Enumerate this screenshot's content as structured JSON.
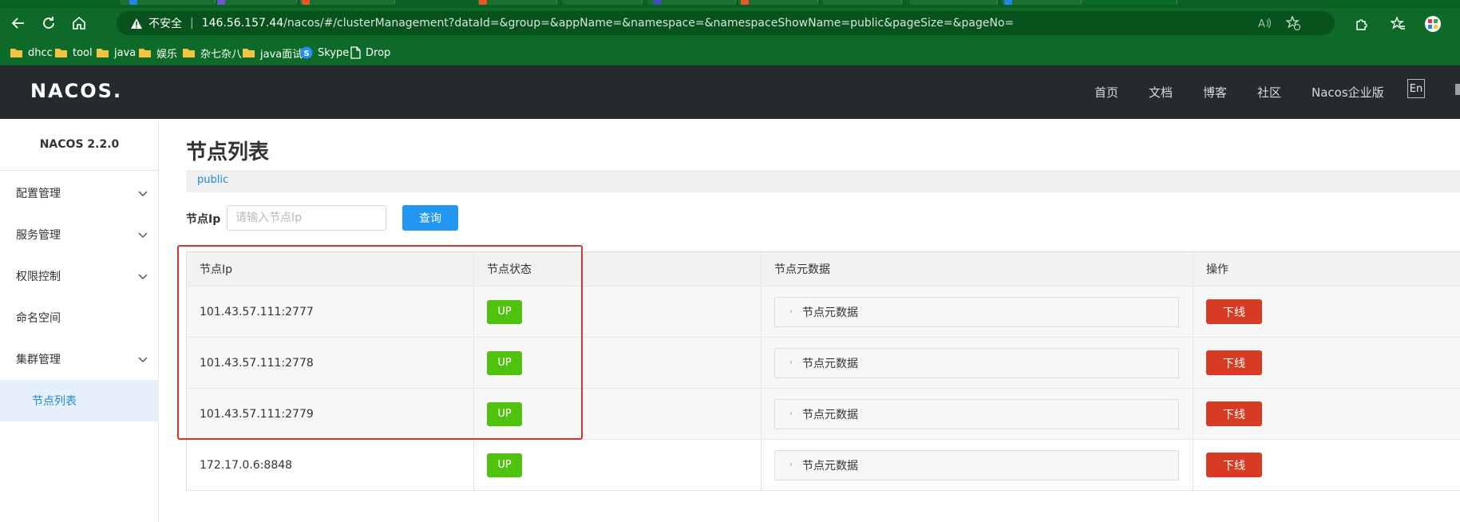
{
  "browser": {
    "address": {
      "insecure_label": "不安全",
      "host": "146.56.157.44",
      "path": "/nacos/#/clusterManagement?dataId=&group=&appName=&namespace=&namespaceShowName=public&pageSize=&pageNo="
    },
    "bookmarks": [
      {
        "label": "dhcc",
        "icon": "folder-icon"
      },
      {
        "label": "tool",
        "icon": "folder-icon"
      },
      {
        "label": "java",
        "icon": "folder-icon"
      },
      {
        "label": "娱乐",
        "icon": "folder-icon"
      },
      {
        "label": "杂七杂八",
        "icon": "folder-icon"
      },
      {
        "label": "java面试",
        "icon": "folder-icon"
      },
      {
        "label": "Skype",
        "icon": "skype-icon"
      },
      {
        "label": "Drop",
        "icon": "page-icon"
      }
    ],
    "colors": {
      "chrome": "#0d6a28",
      "url_bg": "#08521d"
    }
  },
  "header": {
    "logo": "NACOS.",
    "nav": [
      "首页",
      "文档",
      "博客",
      "社区",
      "Nacos企业版"
    ],
    "lang": "En"
  },
  "sidebar": {
    "version": "NACOS 2.2.0",
    "items": [
      {
        "label": "配置管理",
        "expandable": true
      },
      {
        "label": "服务管理",
        "expandable": true
      },
      {
        "label": "权限控制",
        "expandable": true
      },
      {
        "label": "命名空间",
        "expandable": false
      },
      {
        "label": "集群管理",
        "expandable": true
      },
      {
        "label": "节点列表",
        "expandable": false,
        "active": true
      }
    ]
  },
  "main": {
    "title": "节点列表",
    "namespace": "public",
    "filter": {
      "label": "节点Ip",
      "placeholder": "请输入节点Ip",
      "value": "",
      "button": "查询"
    },
    "table": {
      "columns": [
        "节点Ip",
        "节点状态",
        "节点元数据",
        "操作"
      ],
      "rows": [
        {
          "ip": "101.43.57.111:2777",
          "status": "UP",
          "metadata": "节点元数据",
          "action": "下线"
        },
        {
          "ip": "101.43.57.111:2778",
          "status": "UP",
          "metadata": "节点元数据",
          "action": "下线"
        },
        {
          "ip": "101.43.57.111:2779",
          "status": "UP",
          "metadata": "节点元数据",
          "action": "下线"
        },
        {
          "ip": "172.17.0.6:8848",
          "status": "UP",
          "metadata": "节点元数据",
          "action": "下线"
        }
      ]
    },
    "colors": {
      "status_up": "#4ec20d",
      "offline_button": "#d73b23",
      "query_button": "#2196f3",
      "highlight": "#e03131"
    }
  }
}
